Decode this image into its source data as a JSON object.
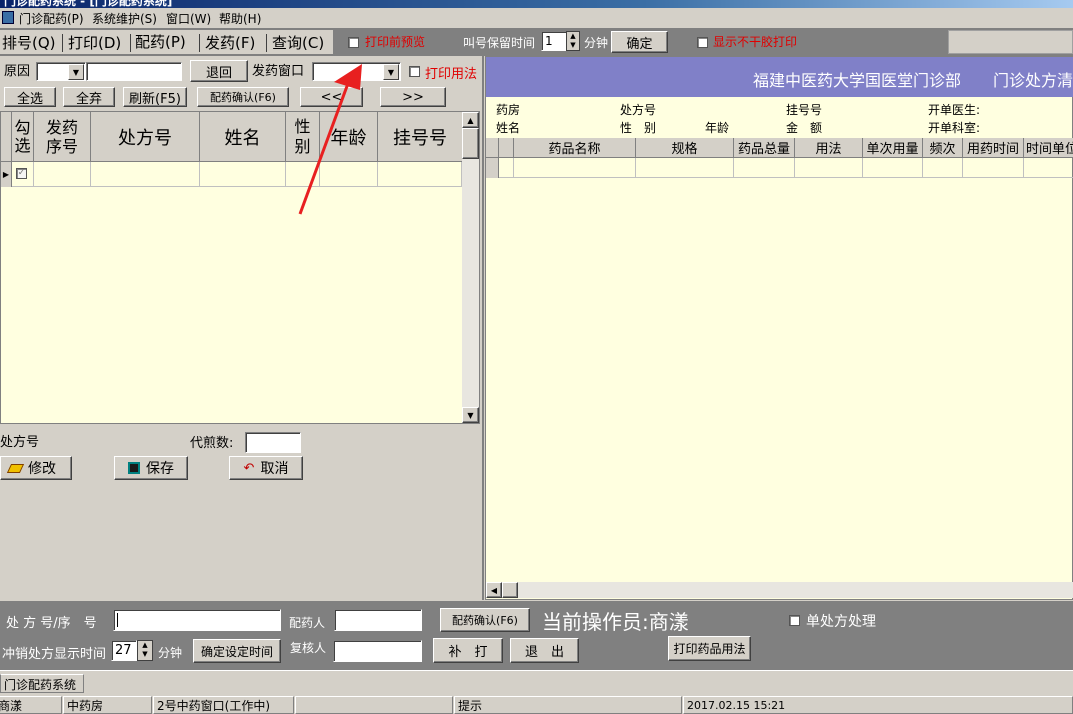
{
  "window": {
    "title": "门诊配药系统 - [门诊配药系统]"
  },
  "menu": [
    "门诊配药(P)",
    "系统维护(S)",
    "窗口(W)",
    "帮助(H)"
  ],
  "tabs": [
    "排号(Q)",
    "打印(D)",
    "配药(P)",
    "发药(F)",
    "查询(C)"
  ],
  "toolbar": {
    "print_preview": "打印前预览",
    "hold_time_label": "叫号保留时间",
    "hold_time_value": "1",
    "minute": "分钟",
    "confirm": "确定",
    "show_no_print": "显示不干胶打印"
  },
  "left": {
    "reason_label": "原因",
    "return_btn": "退回",
    "window_label": "发药窗口",
    "print_usage": "打印用法",
    "select_all": "全选",
    "clear_all": "全弃",
    "refresh": "刷新(F5)",
    "dispense_confirm": "配药确认(F6)",
    "prev": "<<",
    "next": ">>",
    "columns": [
      "勾选",
      "发药序号",
      "处方号",
      "姓名",
      "性别",
      "年龄",
      "挂号号"
    ],
    "rx_label": "处方号",
    "decoct_label": "代煎数:",
    "modify": "修改",
    "save": "保存",
    "cancel": "取消"
  },
  "right": {
    "header_title": "福建中医药大学国医堂门诊部　　门诊处方清单",
    "info": {
      "pharmacy": "药房",
      "rx_no": "处方号",
      "reg_no": "挂号号",
      "doctor": "开单医生:",
      "name": "姓名",
      "sex": "性　别",
      "age": "年龄",
      "amount": "金　额",
      "dept": "开单科室:"
    },
    "columns": [
      "药品名称",
      "规格",
      "药品总量",
      "用法",
      "单次用量",
      "频次",
      "用药时间",
      "时间单位"
    ]
  },
  "bottom": {
    "rx_seq_label": "处 方 号/序　号",
    "dispenser_label": "配药人",
    "dispense_confirm": "配药确认(F6)",
    "operator_text": "当前操作员:商漾",
    "single_rx": "单处方处理",
    "cancel_time_label": "冲销处方显示时间",
    "cancel_time_value": "27",
    "minute": "分钟",
    "set_time": "确定设定时间",
    "reviewer_label": "复核人",
    "reprint": "补　打",
    "exit": "退　出",
    "print_usage": "打印药品用法"
  },
  "taskbar": {
    "item": "门诊配药系统"
  },
  "statusbar": [
    "商漾",
    "中药房",
    "2号中药窗口(工作中)",
    "",
    "提示",
    "2017.02.15 15:21"
  ]
}
